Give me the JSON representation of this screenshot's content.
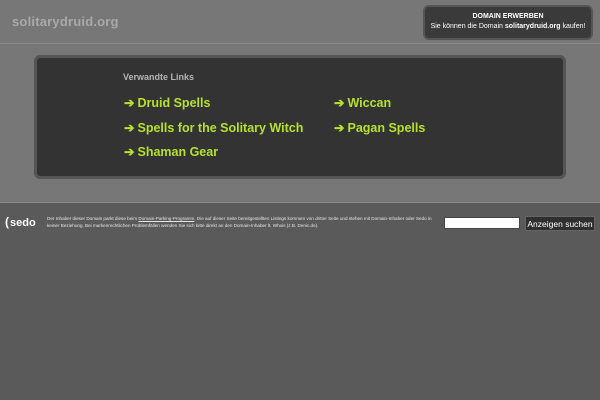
{
  "header": {
    "site_title": "solitarydruid.org"
  },
  "buy_box": {
    "title": "DOMAIN ERWERBEN",
    "text_prefix": "Sie können die Domain ",
    "domain": "solitarydruid.org",
    "text_suffix": " kaufen!"
  },
  "links_panel": {
    "title": "Verwandte Links",
    "arrow": "➔",
    "links": [
      {
        "label": "Druid Spells"
      },
      {
        "label": "Spells for the Solitary Witch"
      },
      {
        "label": "Shaman Gear"
      },
      {
        "label": "Wiccan"
      },
      {
        "label": "Pagan Spells"
      }
    ]
  },
  "footer": {
    "logo_text": "sedo",
    "logo_mark": "(",
    "disclaimer_pre": "Der Inhaber dieser Domain parkt diese beim ",
    "disclaimer_link": "Domain-Parking-Programm",
    "disclaimer_post": ". Die auf dieser Seite bereitgestellten Listings kommen von dritter Seite und stehen mit Domain-Inhaber oder Sedo in keiner Beziehung. Bei markenrechtlichen Problemfällen wenden Sie sich bitte direkt an den Domain-Inhaber lt. Whois (z.B. Denic.de).",
    "search_value": "",
    "search_button": "Anzeigen suchen"
  },
  "colors": {
    "link": "#b7e12a",
    "panel": "#333333",
    "band": "#777777",
    "page": "#5a5a5a"
  }
}
